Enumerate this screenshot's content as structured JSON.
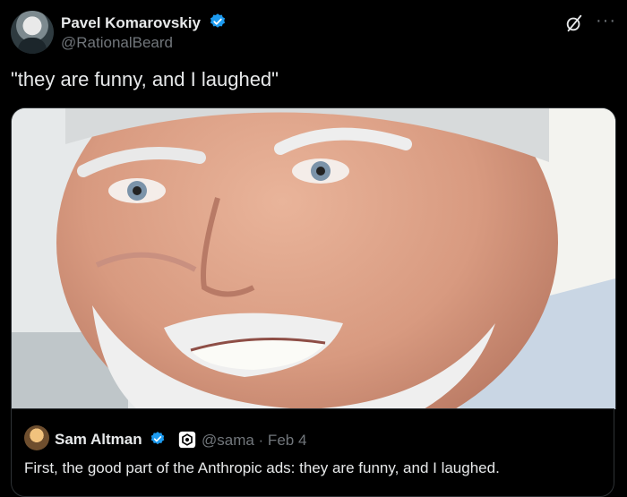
{
  "post": {
    "author_name": "Pavel Komarovskiy",
    "author_handle": "@RationalBeard",
    "text": "\"they are funny, and I laughed\"",
    "more_label": "···"
  },
  "quoted": {
    "author_name": "Sam Altman",
    "meta": "@sama · Feb 4",
    "text": "First, the good part of the Anthropic ads: they are funny, and I laughed."
  },
  "colors": {
    "verified": "#1d9bf0",
    "muted": "#71767b",
    "text": "#e7e9ea"
  },
  "icons": {
    "grok": "grok-icon",
    "more": "more-icon",
    "verified": "verified-badge-icon"
  }
}
